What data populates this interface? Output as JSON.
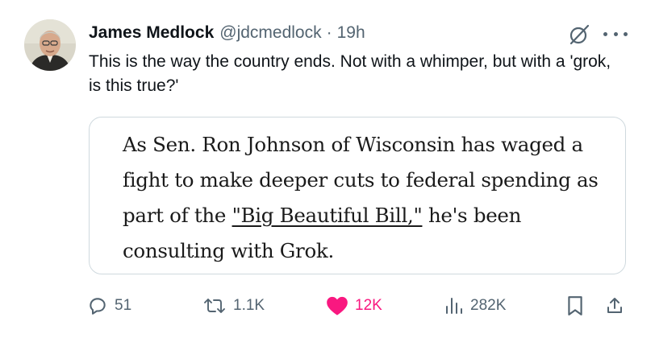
{
  "tweet": {
    "author_name": "James Medlock",
    "handle": "@jdcmedlock",
    "separator": "·",
    "time": "19h",
    "text": "This is the way the country ends. Not with a whimper, but with a 'grok, is this true?'"
  },
  "quote_card": {
    "text_before": "As Sen. Ron Johnson of Wisconsin has waged a fight to make deeper cuts to federal spending as part of the ",
    "link_text": "\"Big Beautiful Bill,\"",
    "text_after": " he's been consulting with Grok."
  },
  "actions": {
    "replies": "51",
    "reposts": "1.1K",
    "likes": "12K",
    "views": "282K"
  },
  "icons": {
    "header": [
      "grok-icon",
      "more-icon"
    ],
    "actions": [
      "reply-icon",
      "repost-icon",
      "heart-icon",
      "views-icon",
      "bookmark-icon",
      "share-icon"
    ]
  },
  "colors": {
    "text": "#0f1419",
    "muted": "#536471",
    "like": "#f91880",
    "border": "#cfd9de"
  }
}
